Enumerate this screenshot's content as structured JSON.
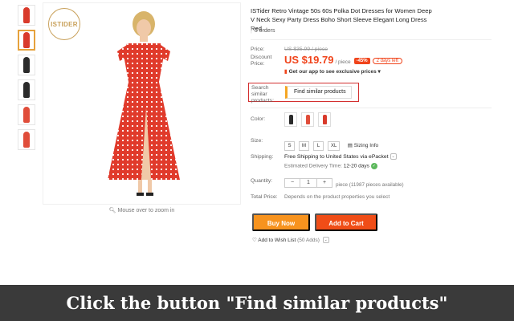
{
  "brand": {
    "logo_text": "ISTIDER"
  },
  "gallery": {
    "thumb_colors": [
      "#d93a2b",
      "#d93a2b",
      "#2a2a2a",
      "#2a2a2a",
      "#e04d3a",
      "#e04d3a"
    ],
    "zoom_hint": "Mouse over to zoom in",
    "dress_color": "#e03a2b"
  },
  "product": {
    "title": "ISTider Retro Vintage 50s 60s Polka Dot Dresses for Women Deep V Neck Sexy Party Dress Boho Short Sleeve Elegant Long Dress Red",
    "orders": "3 orders"
  },
  "price": {
    "label": "Price:",
    "original": "US $35.99 / piece",
    "discount_label": "Discount Price:",
    "current": "US $19.79",
    "per": "/ piece",
    "discount_badge": "-45%",
    "days_left": "2 days left",
    "app_link": "Get our app to see exclusive prices"
  },
  "similar": {
    "label": "Search similar products:",
    "button": "Find similar products"
  },
  "options": {
    "color_label": "Color:",
    "colors": [
      "#2a2a2a",
      "#e04d3a",
      "#d93a2b"
    ],
    "size_label": "Size:",
    "sizes": [
      "S",
      "M",
      "L",
      "XL"
    ],
    "sizing_info": "Sizing Info"
  },
  "shipping": {
    "label": "Shipping:",
    "main": "Free Shipping to United States via ePacket",
    "delivery_prefix": "Estimated Delivery Time:",
    "delivery_days": "12-20 days"
  },
  "quantity": {
    "label": "Quantity:",
    "minus": "−",
    "value": "1",
    "plus": "+",
    "available": "piece (11987 pieces available)"
  },
  "total": {
    "label": "Total Price:",
    "text": "Depends on the product properties you select"
  },
  "actions": {
    "buy_now": "Buy Now",
    "add_to_cart": "Add to Cart",
    "wishlist": "Add to Wish List",
    "wishlist_count": "(50 Adds)"
  },
  "caption": "Click the button \"Find similar products\"",
  "colors": {
    "accent": "#f0441b",
    "buy": "#f7931e",
    "highlight": "#d32f2f"
  }
}
